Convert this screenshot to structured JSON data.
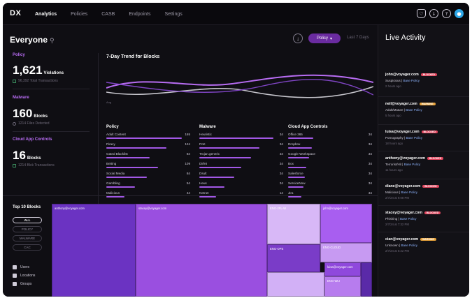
{
  "app": {
    "logo": "DX"
  },
  "nav": [
    {
      "label": "Analytics",
      "active": true
    },
    {
      "label": "Policies",
      "active": false
    },
    {
      "label": "CASB",
      "active": false
    },
    {
      "label": "Endpoints",
      "active": false
    },
    {
      "label": "Settings",
      "active": false
    }
  ],
  "header": {
    "title": "Everyone",
    "filter_label": "Policy",
    "range_label": "Last 7 Days"
  },
  "metrics": [
    {
      "label": "Policy",
      "value": "1,621",
      "unit": "Violations",
      "sub": "96,392 Total Transactions"
    },
    {
      "label": "Malware",
      "value": "160",
      "unit": "Blocks",
      "sub": "1214 Files Detected"
    },
    {
      "label": "Cloud App Controls",
      "value": "16",
      "unit": "Blocks",
      "sub": "1214 Blck Transactions"
    }
  ],
  "trend": {
    "title": "7-Day Trend for Blocks",
    "tick": "Aug"
  },
  "columns": [
    {
      "title": "Policy",
      "rows": [
        {
          "name": "Adult Content",
          "value": "165",
          "fill": 0.9
        },
        {
          "name": "Piracy",
          "value": "124",
          "fill": 0.72
        },
        {
          "name": "Gated Blacklist",
          "value": "84",
          "fill": 0.52
        },
        {
          "name": "Betting",
          "value": "109",
          "fill": 0.62
        },
        {
          "name": "Social Media",
          "value": "84",
          "fill": 0.48
        },
        {
          "name": "Gambling",
          "value": "54",
          "fill": 0.34
        },
        {
          "name": "Malicious",
          "value": "44",
          "fill": 0.22
        }
      ]
    },
    {
      "title": "Malware",
      "rows": [
        {
          "name": "Heuristic",
          "value": "34",
          "fill": 0.88
        },
        {
          "name": "PoK",
          "value": "34",
          "fill": 0.72
        },
        {
          "name": "Trojan.generic",
          "value": "34",
          "fill": 0.62
        },
        {
          "name": "Dirfet",
          "value": "34",
          "fill": 0.5
        },
        {
          "name": "Dsult",
          "value": "34",
          "fill": 0.42
        },
        {
          "name": "Heus",
          "value": "34",
          "fill": 0.3
        },
        {
          "name": "Netnet",
          "value": "14",
          "fill": 0.2
        }
      ]
    },
    {
      "title": "Cloud App Controls",
      "rows": [
        {
          "name": "Office 365",
          "value": "34",
          "fill": 0.3
        },
        {
          "name": "Dropbox",
          "value": "34",
          "fill": 0.28
        },
        {
          "name": "Google Workspace",
          "value": "34",
          "fill": 0.25
        },
        {
          "name": "Box",
          "value": "34",
          "fill": 0.22
        },
        {
          "name": "Salesforce",
          "value": "34",
          "fill": 0.2
        },
        {
          "name": "ServiceNow",
          "value": "34",
          "fill": 0.18
        },
        {
          "name": "Jira",
          "value": "34",
          "fill": 0.16
        }
      ]
    }
  ],
  "top10": {
    "title": "Top 10 Blocks",
    "filters": [
      {
        "label": "ALL",
        "active": true
      },
      {
        "label": "POLICY",
        "active": false
      },
      {
        "label": "MALWARE",
        "active": false
      },
      {
        "label": "CAC",
        "active": false
      }
    ],
    "checks": [
      "Users",
      "Locations",
      "Groups"
    ],
    "tiles": [
      "anthony@voyager.com",
      "stacey@voyager.com",
      "ENG-2FL-W",
      "john@voyager.com",
      "ENG-OPS",
      "ENG-CLOUD",
      "luisa@voyager.com",
      "ENG-WLI"
    ]
  },
  "sidebar": {
    "title": "Live Activity",
    "items": [
      {
        "email": "john@voyager.com",
        "tag": "BLOCKED",
        "tag_color": "#e2475f",
        "line2a": "Suspicious",
        "line2b": "Base Policy",
        "time": "2 hours ago"
      },
      {
        "email": "neil@voyager.com",
        "tag": "WARNING",
        "tag_color": "#e8a33b",
        "line2a": "Adult/Mature",
        "line2b": "Base Policy",
        "time": "5 hours ago"
      },
      {
        "email": "luisa@voyager.com",
        "tag": "BLOCKED",
        "tag_color": "#e2475f",
        "line2a": "Pornography",
        "line2b": "Base Policy",
        "time": "18 hours ago"
      },
      {
        "email": "anthony@voyager.com",
        "tag": "BLOCKED",
        "tag_color": "#e2475f",
        "line2a": "Terrorist/Hit",
        "line2b": "Base Policy",
        "time": "11 hours ago"
      },
      {
        "email": "diane@voyager.com",
        "tag": "BLOCKED",
        "tag_color": "#e2475f",
        "line2a": "Malicious",
        "line2b": "Base Policy",
        "time": "2/7/24 at 9:08 PM"
      },
      {
        "email": "stacey@voyager.com",
        "tag": "BLOCKED",
        "tag_color": "#e2475f",
        "line2a": "Phishing",
        "line2b": "Base Policy",
        "time": "2/7/24 at 7:32 PM"
      },
      {
        "email": "cian@voyager.com",
        "tag": "WARNING",
        "tag_color": "#e8a33b",
        "line2a": "Unknown",
        "line2b": "Base Policy",
        "time": "2/7/24 at 6:22 PM"
      }
    ]
  },
  "colors": {
    "accent": "#a258e6",
    "pill": "#6a2ba0",
    "bg": "#0f0e13"
  }
}
